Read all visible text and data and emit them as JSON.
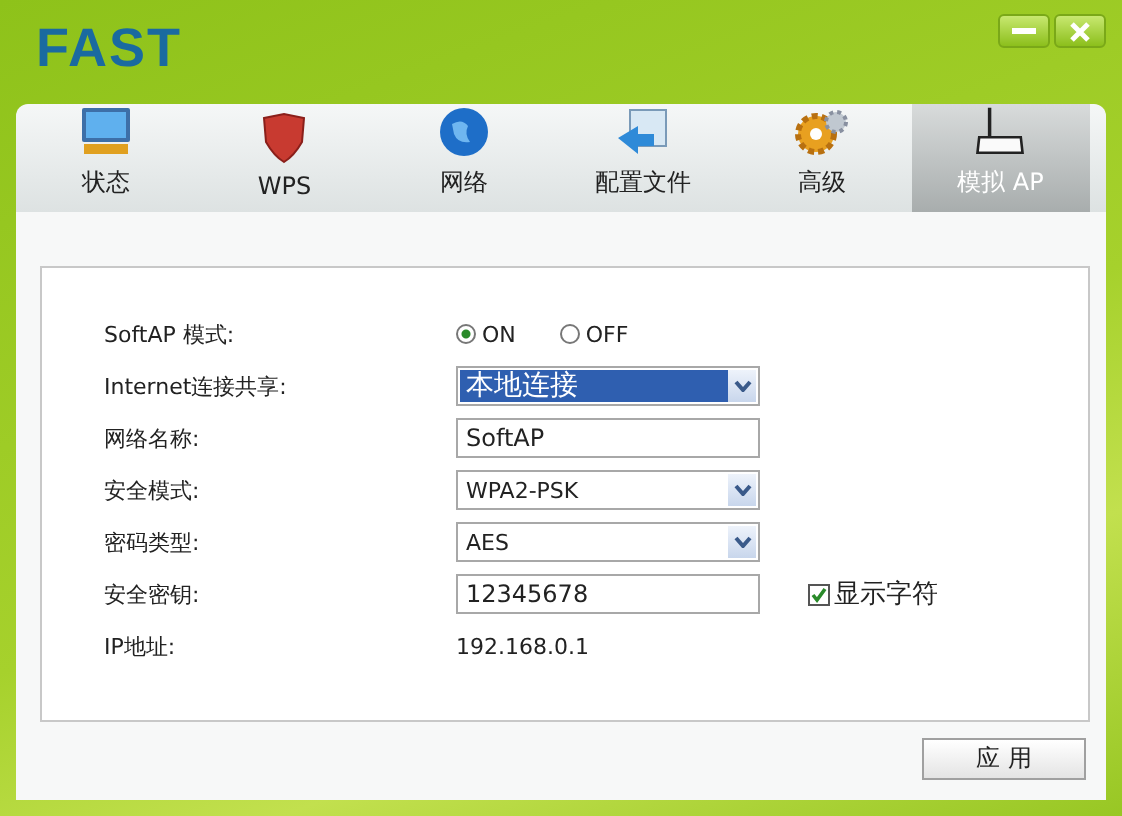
{
  "window": {
    "logo": "FAST"
  },
  "tabs": [
    {
      "label": "状态",
      "kind": "monitor",
      "selected": false
    },
    {
      "label": "WPS",
      "kind": "shield",
      "selected": false
    },
    {
      "label": "网络",
      "kind": "globe",
      "selected": false
    },
    {
      "label": "配置文件",
      "kind": "profile",
      "selected": false
    },
    {
      "label": "高级",
      "kind": "gears",
      "selected": false
    },
    {
      "label": "模拟 AP",
      "kind": "router",
      "selected": true
    }
  ],
  "fields": [
    {
      "kind": "radio",
      "label": "SoftAP 模式:",
      "options": [
        {
          "label": "ON",
          "selected": true
        },
        {
          "label": "OFF",
          "selected": false
        }
      ]
    },
    {
      "kind": "select",
      "label": "Internet连接共享:",
      "value": "本地连接",
      "highlighted": true
    },
    {
      "kind": "text",
      "label": "网络名称:",
      "value": "SoftAP"
    },
    {
      "kind": "select",
      "label": "安全模式:",
      "value": "WPA2-PSK",
      "highlighted": false
    },
    {
      "kind": "select",
      "label": "密码类型:",
      "value": "AES",
      "highlighted": false
    },
    {
      "kind": "text",
      "label": "安全密钥:",
      "value": "12345678",
      "option": {
        "label": "显示字符",
        "checked": true
      }
    },
    {
      "kind": "static",
      "label": "IP地址:",
      "value": "192.168.0.1"
    }
  ],
  "apply_button": "应 用"
}
